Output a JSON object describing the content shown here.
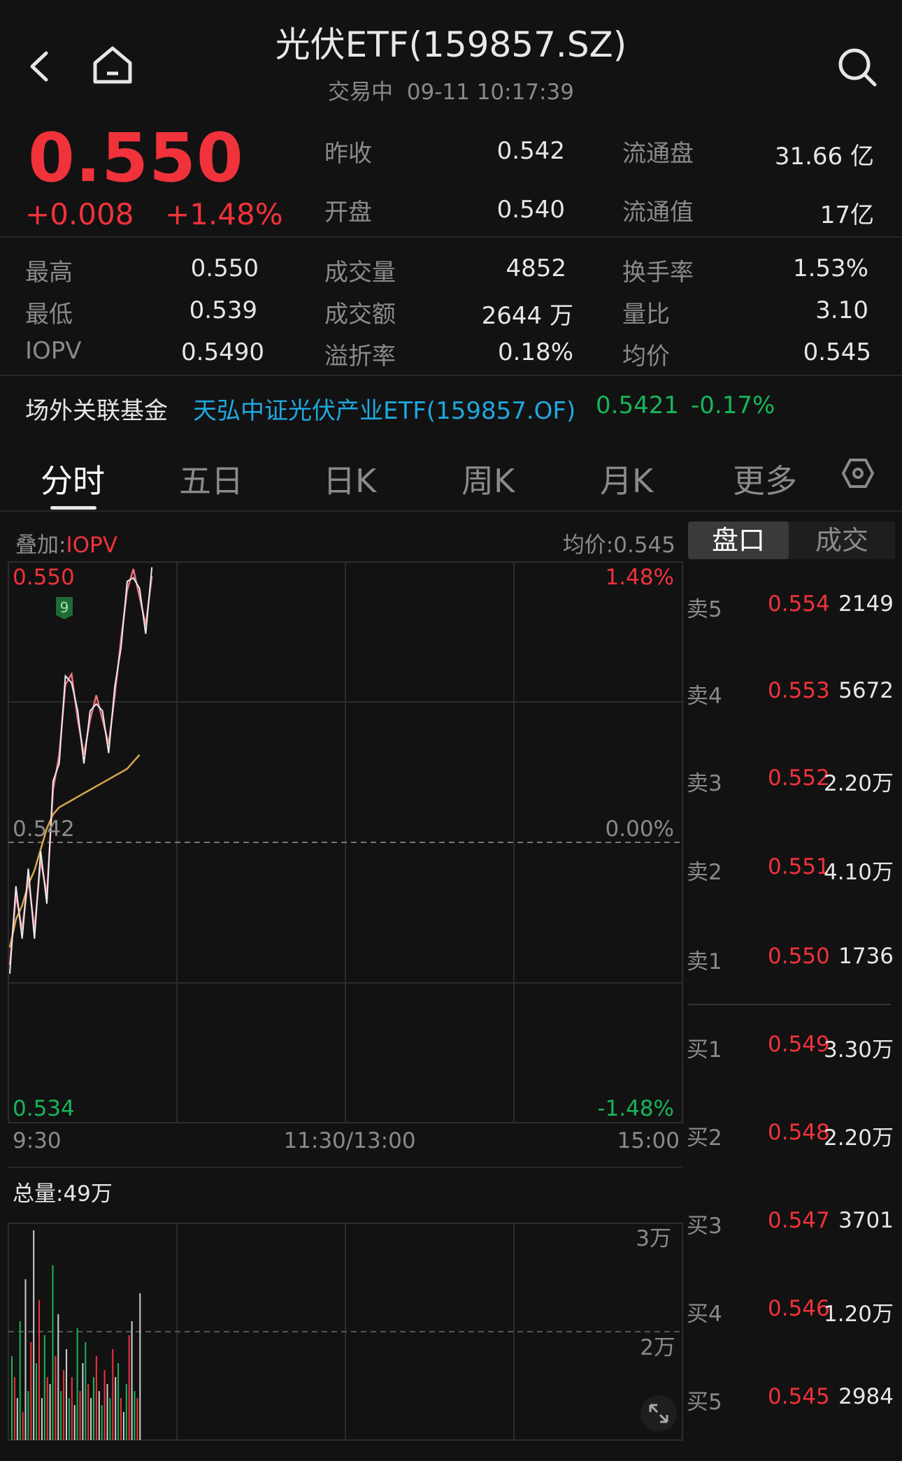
{
  "header": {
    "title": "光伏ETF(159857.SZ)",
    "status": "交易中",
    "datetime": "09-11 10:17:39"
  },
  "quote": {
    "price": "0.550",
    "change": "+0.008",
    "change_pct": "+1.48%",
    "stats": [
      {
        "label": "昨收",
        "value": "0.542"
      },
      {
        "label": "流通盘",
        "value": "31.66 亿"
      },
      {
        "label": "开盘",
        "value": "0.540"
      },
      {
        "label": "流通值",
        "value": "17亿"
      },
      {
        "label": "最高",
        "value": "0.550"
      },
      {
        "label": "成交量",
        "value": "4852"
      },
      {
        "label": "换手率",
        "value": "1.53%"
      },
      {
        "label": "最低",
        "value": "0.539"
      },
      {
        "label": "成交额",
        "value": "2644 万"
      },
      {
        "label": "量比",
        "value": "3.10"
      },
      {
        "label": "IOPV",
        "value": "0.5490"
      },
      {
        "label": "溢折率",
        "value": "0.18%"
      },
      {
        "label": "均价",
        "value": "0.545"
      }
    ]
  },
  "related_fund": {
    "label": "场外关联基金",
    "name": "天弘中证光伏产业ETF(159857.OF)",
    "nav": "0.5421",
    "change_pct": "-0.17%"
  },
  "tabs": [
    "分时",
    "五日",
    "日K",
    "周K",
    "月K",
    "更多"
  ],
  "chart": {
    "overlay_label": "叠加:",
    "overlay_value": "IOPV",
    "avg_label": "均价:0.545",
    "y_top": "0.550",
    "y_mid": "0.542",
    "y_bottom": "0.534",
    "pct_top": "1.48%",
    "pct_mid": "0.00%",
    "pct_bottom": "-1.48%",
    "x_start": "9:30",
    "x_mid": "11:30/13:00",
    "x_end": "15:00",
    "marker": "9",
    "volume_label": "总量:49万",
    "vol_top": "3万",
    "vol_mid": "2万"
  },
  "chart_data": {
    "type": "line",
    "ylim": [
      0.534,
      0.55
    ],
    "series": [
      {
        "values": [
          0.5385,
          0.5405,
          0.5395,
          0.541,
          0.5395,
          0.5415,
          0.5405,
          0.5435,
          0.5445,
          0.5465,
          0.5468,
          0.5455,
          0.5445,
          0.5455,
          0.5462,
          0.5455,
          0.5448,
          0.5462,
          0.5478,
          0.5492,
          0.5498,
          0.549,
          0.5482,
          0.5496
        ]
      },
      {
        "values": [
          0.539,
          0.5398,
          0.5402,
          0.5408,
          0.5412,
          0.5418,
          0.5424,
          0.5428,
          0.543,
          0.5431,
          0.5432,
          0.5433,
          0.5434,
          0.5435,
          0.5436,
          0.5437,
          0.5438,
          0.5439,
          0.544,
          0.5441,
          0.5443,
          0.5445
        ]
      }
    ]
  },
  "order_book": {
    "tab_active": "盘口",
    "tab_other": "成交",
    "asks": [
      {
        "label": "卖5",
        "price": "0.554",
        "qty": "2149"
      },
      {
        "label": "卖4",
        "price": "0.553",
        "qty": "5672"
      },
      {
        "label": "卖3",
        "price": "0.552",
        "qty": "2.20万"
      },
      {
        "label": "卖2",
        "price": "0.551",
        "qty": "4.10万"
      },
      {
        "label": "卖1",
        "price": "0.550",
        "qty": "1736"
      }
    ],
    "bids": [
      {
        "label": "买1",
        "price": "0.549",
        "qty": "3.30万"
      },
      {
        "label": "买2",
        "price": "0.548",
        "qty": "2.20万"
      },
      {
        "label": "买3",
        "price": "0.547",
        "qty": "3701"
      },
      {
        "label": "买4",
        "price": "0.546",
        "qty": "1.20万"
      },
      {
        "label": "买5",
        "price": "0.545",
        "qty": "2984"
      }
    ]
  },
  "colors": {
    "up": "#f0323a",
    "down": "#19b45a",
    "bg": "#121212",
    "avg": "#d9a84a"
  }
}
